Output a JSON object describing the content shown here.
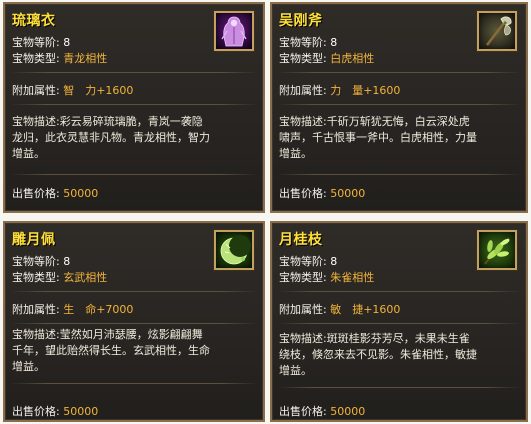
{
  "cards": [
    {
      "title": "琉璃衣",
      "icon": "robe-icon",
      "grade_label": "宝物等阶:",
      "grade_value": "8",
      "type_label": "宝物类型:",
      "type_value": "青龙相性",
      "bonus_label": "附加属性:",
      "bonus_value": "智　力+1600",
      "desc_lines": [
        "宝物描述:彩云易碎琉璃脆，青岚一袭隐",
        "龙归，此衣灵慧非凡物。青龙相性，智力",
        "增益。"
      ],
      "price_label": "出售价格:",
      "price_value": "50000"
    },
    {
      "title": "吴刚斧",
      "icon": "axe-icon",
      "grade_label": "宝物等阶:",
      "grade_value": "8",
      "type_label": "宝物类型:",
      "type_value": "白虎相性",
      "bonus_label": "附加属性:",
      "bonus_value": "力　量+1600",
      "desc_lines": [
        "宝物描述:千斫万斩犹无悔，白云深处虎",
        "啸声，千古恨事一斧中。白虎相性，力量",
        "增益。"
      ],
      "price_label": "出售价格:",
      "price_value": "50000"
    },
    {
      "title": "雕月佩",
      "icon": "moon-pendant-icon",
      "grade_label": "宝物等阶:",
      "grade_value": "8",
      "type_label": "宝物类型:",
      "type_value": "玄武相性",
      "bonus_label": "附加属性:",
      "bonus_value": "生　命+7000",
      "desc_lines": [
        "宝物描述:莹然如月沛瑟腰，炫影翩翩舞",
        "千年，望此贻然得长生。玄武相性，生命",
        "增益。"
      ],
      "price_label": "出售价格:",
      "price_value": "50000"
    },
    {
      "title": "月桂枝",
      "icon": "laurel-branch-icon",
      "grade_label": "宝物等阶:",
      "grade_value": "8",
      "type_label": "宝物类型:",
      "type_value": "朱雀相性",
      "bonus_label": "附加属性:",
      "bonus_value": "敏　捷+1600",
      "desc_lines": [
        "宝物描述:斑斑桂影芬芳尽，未果未生雀",
        "绕枝，倏忽来去不见影。朱雀相性，敏捷",
        "增益。"
      ],
      "price_label": "出售价格:",
      "price_value": "50000"
    }
  ],
  "colors": {
    "title": "#ffe03a",
    "gold_value": "#f2b43a",
    "border": "#8a6e4b",
    "panel": "#2a2724"
  }
}
